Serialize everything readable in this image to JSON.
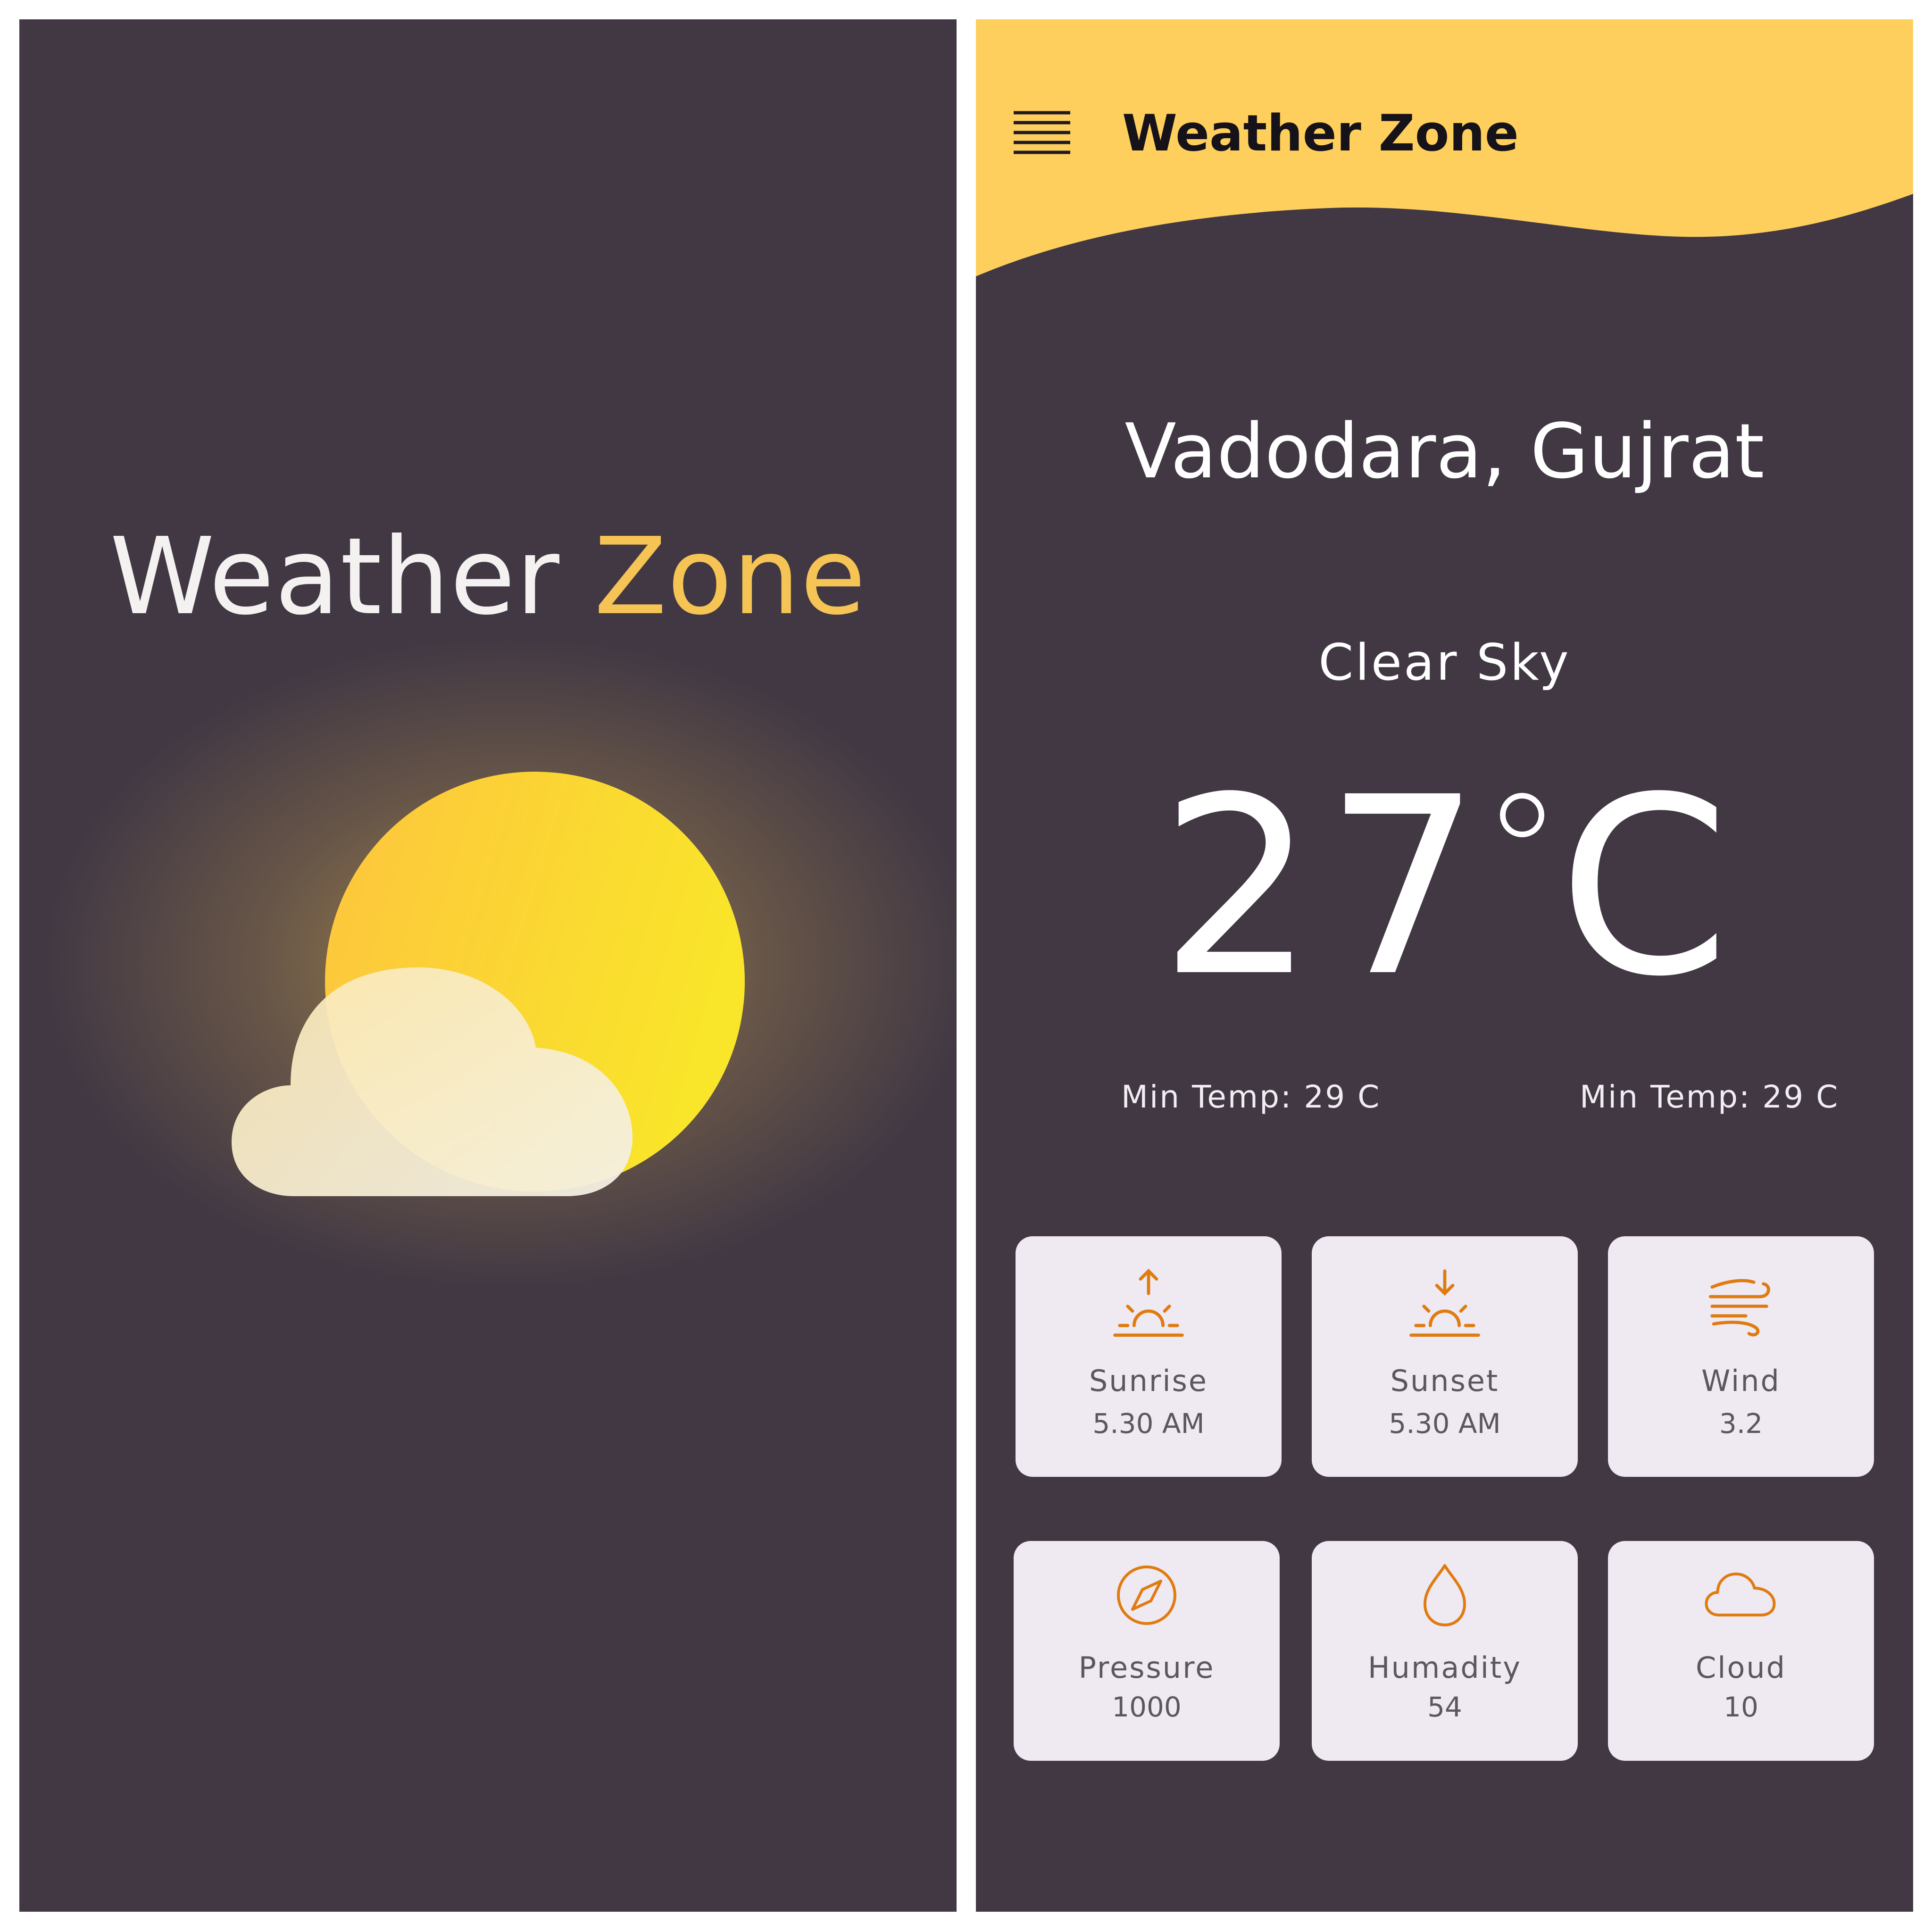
{
  "splash": {
    "title_part1": "Weather ",
    "title_part2": "Zone",
    "accent_color": "#f5c454",
    "illustration": "sun-behind-cloud-icon"
  },
  "home": {
    "header": {
      "menu_icon": "hamburger-menu-icon",
      "title": "Weather Zone",
      "header_color": "#fecf5c"
    },
    "location": "Vadodara, Gujrat",
    "condition": "Clear Sky",
    "temperature": {
      "value": "27",
      "unit": "C",
      "degree_symbol": "°"
    },
    "min_temp_left": "Min Temp: 29 C",
    "min_temp_right": "Min Temp: 29 C",
    "stats": [
      {
        "icon": "sunrise-icon",
        "label": "Sunrise",
        "value": "5.30 AM"
      },
      {
        "icon": "sunset-icon",
        "label": "Sunset",
        "value": "5.30 AM"
      },
      {
        "icon": "wind-icon",
        "label": "Wind",
        "value": "3.2"
      },
      {
        "icon": "compass-icon",
        "label": "Pressure",
        "value": "1000"
      },
      {
        "icon": "droplet-icon",
        "label": "Humadity",
        "value": "54"
      },
      {
        "icon": "cloud-icon",
        "label": "Cloud",
        "value": "10"
      }
    ],
    "icon_color": "#e07b10",
    "background_color": "#413844"
  }
}
